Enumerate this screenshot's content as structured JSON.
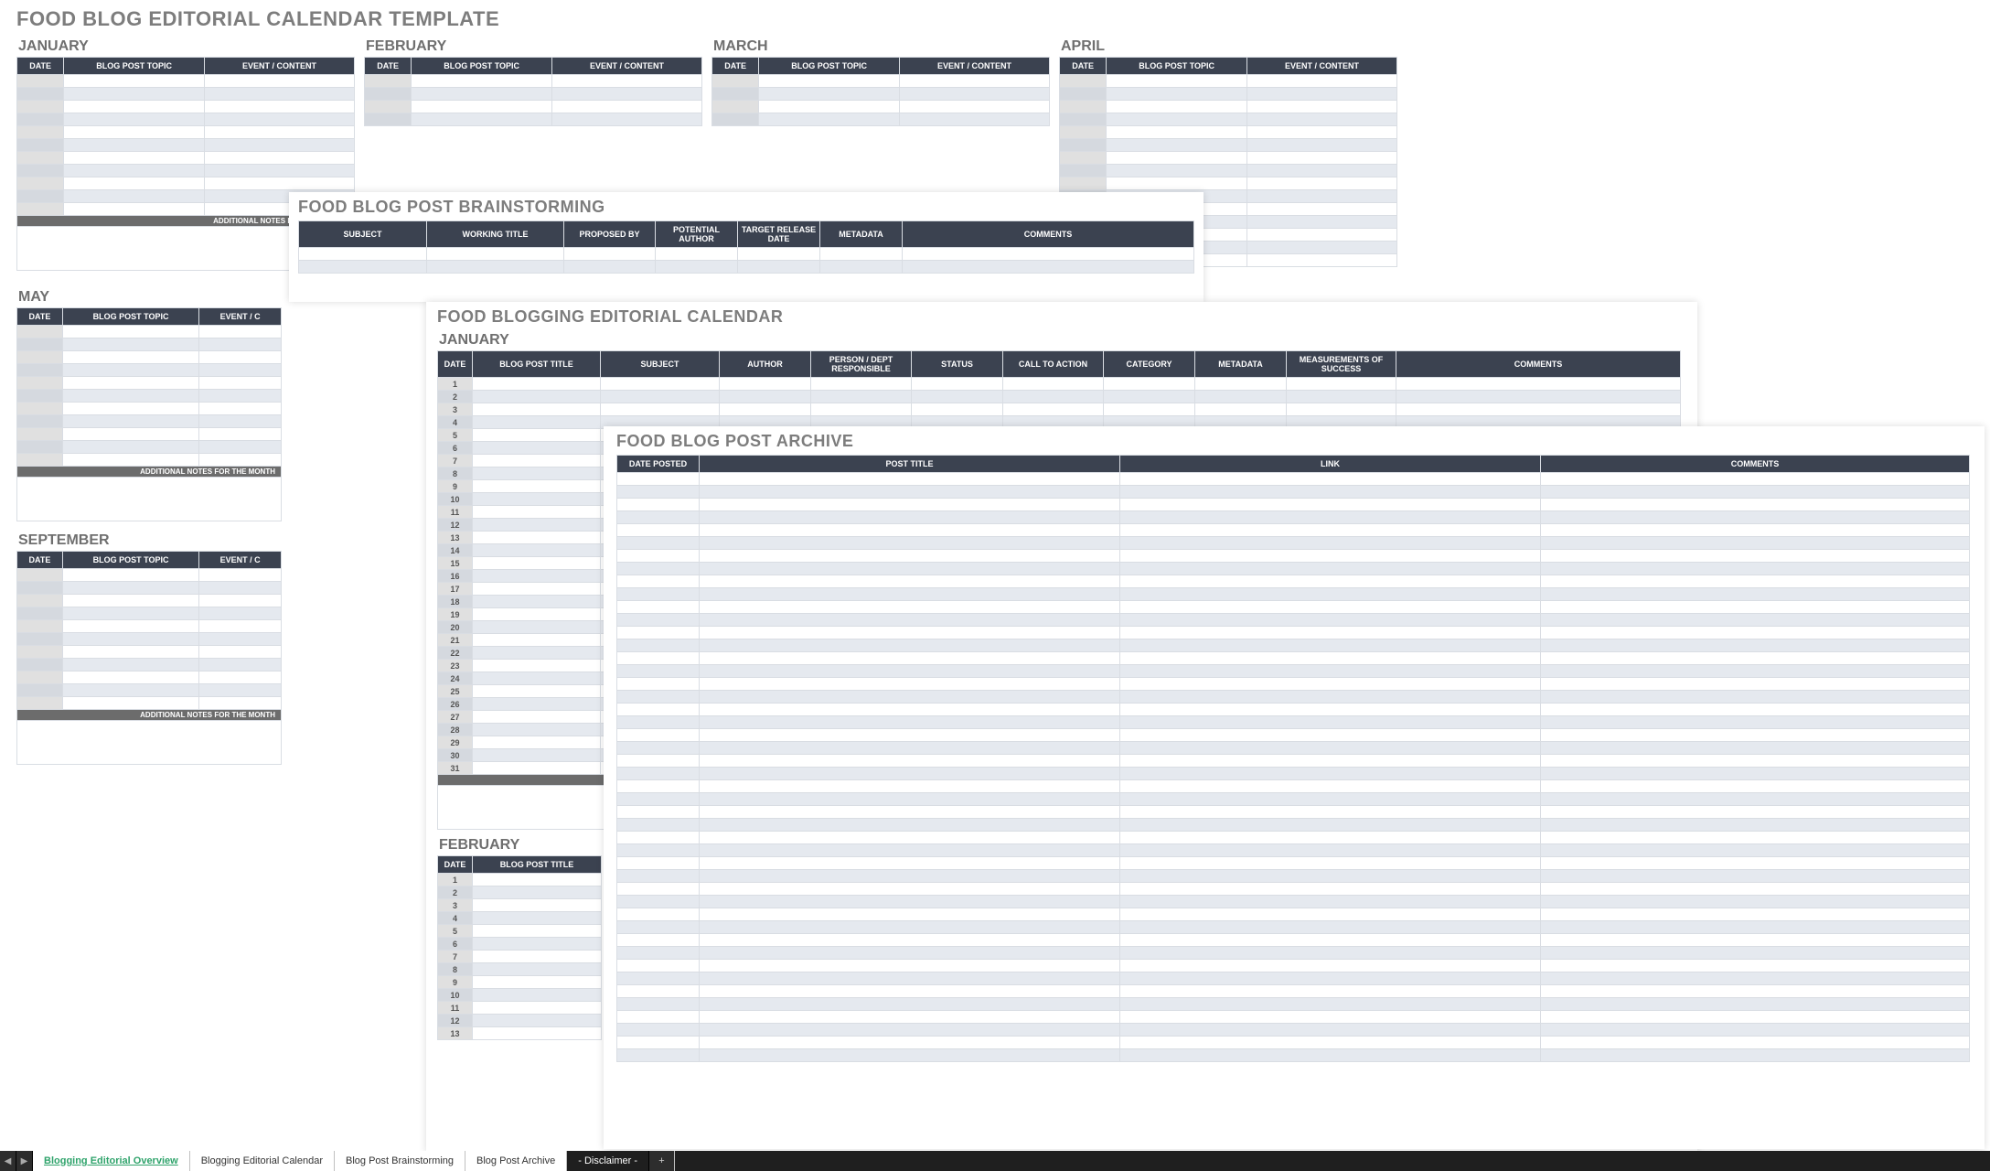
{
  "layer1": {
    "title": "FOOD BLOG EDITORIAL CALENDAR TEMPLATE",
    "months_row1": [
      "JANUARY",
      "FEBRUARY",
      "MARCH",
      "APRIL"
    ],
    "months_col": [
      "MAY",
      "SEPTEMBER"
    ],
    "headers": [
      "DATE",
      "BLOG POST TOPIC",
      "EVENT / CONTENT"
    ],
    "headers_clip": [
      "DATE",
      "BLOG POST TOPIC",
      "EVENT / C"
    ],
    "notes_label": "ADDITIONAL NOTES FOR THE MONTH"
  },
  "layer2": {
    "title": "FOOD BLOG POST BRAINSTORMING",
    "headers": [
      "SUBJECT",
      "WORKING TITLE",
      "PROPOSED BY",
      "POTENTIAL AUTHOR",
      "TARGET RELEASE DATE",
      "METADATA",
      "COMMENTS"
    ]
  },
  "layer3": {
    "title": "FOOD BLOGGING EDITORIAL CALENDAR",
    "months": [
      "JANUARY",
      "FEBRUARY"
    ],
    "headers": [
      "DATE",
      "BLOG POST TITLE",
      "SUBJECT",
      "AUTHOR",
      "PERSON / DEPT RESPONSIBLE",
      "STATUS",
      "CALL TO ACTION",
      "CATEGORY",
      "METADATA",
      "MEASUREMENTS OF SUCCESS",
      "COMMENTS"
    ],
    "headers_short": [
      "DATE",
      "BLOG POST TITLE"
    ],
    "notes_label": "ADDITIONAL NOTES FOR THE MONTH",
    "days_jan": [
      "1",
      "2",
      "3",
      "4",
      "5",
      "6",
      "7",
      "8",
      "9",
      "10",
      "11",
      "12",
      "13",
      "14",
      "15",
      "16",
      "17",
      "18",
      "19",
      "20",
      "21",
      "22",
      "23",
      "24",
      "25",
      "26",
      "27",
      "28",
      "29",
      "30",
      "31"
    ],
    "days_feb": [
      "1",
      "2",
      "3",
      "4",
      "5",
      "6",
      "7",
      "8",
      "9",
      "10",
      "11",
      "12",
      "13"
    ]
  },
  "layer4": {
    "title": "FOOD BLOG POST ARCHIVE",
    "headers": [
      "DATE POSTED",
      "POST TITLE",
      "LINK",
      "COMMENTS"
    ]
  },
  "tabs": {
    "prev": "◀",
    "next": "▶",
    "items": [
      {
        "label": "Blogging Editorial Overview",
        "active": true
      },
      {
        "label": "Blogging Editorial Calendar",
        "active": false
      },
      {
        "label": "Blog Post Brainstorming",
        "active": false
      },
      {
        "label": "Blog Post Archive",
        "active": false
      },
      {
        "label": "- Disclaimer -",
        "active": false,
        "dark": true
      }
    ],
    "plus": "+"
  }
}
